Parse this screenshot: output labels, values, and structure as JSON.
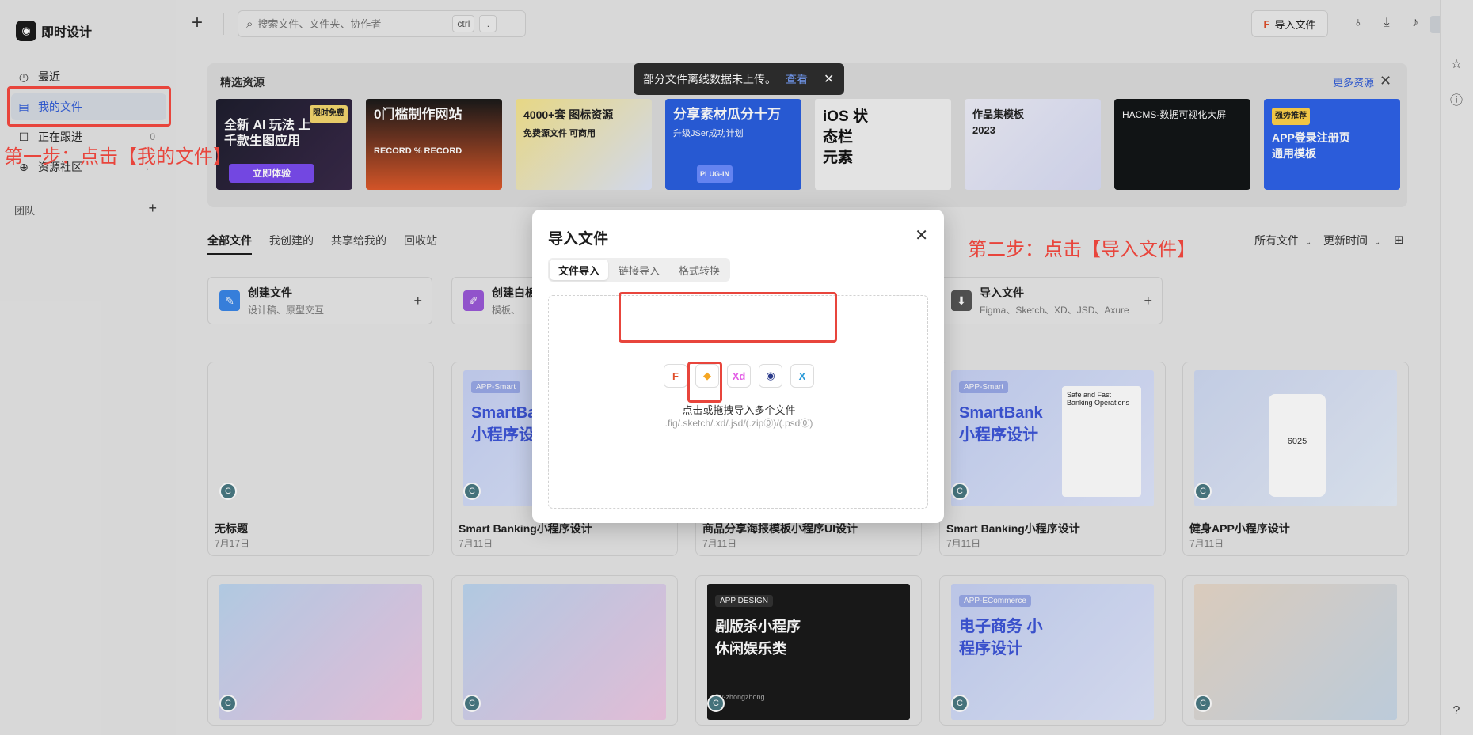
{
  "app": {
    "name": "即时设计"
  },
  "sidebar": {
    "items": [
      {
        "label": "最近",
        "icon": "clock-icon"
      },
      {
        "label": "我的文件",
        "icon": "file-icon"
      },
      {
        "label": "正在跟进",
        "icon": "bookmark-icon",
        "count": "0"
      },
      {
        "label": "资源社区",
        "icon": "globe-icon"
      }
    ],
    "team_label": "团队"
  },
  "topbar": {
    "search_placeholder": "搜索文件、文件夹、协作者",
    "shortcut_key1": "ctrl",
    "shortcut_key2": ".",
    "import_label": "导入文件"
  },
  "resources": {
    "title": "精选资源",
    "more_label": "更多资源",
    "banners": [
      {
        "title": "全新 AI 玩法 上千款生图应用",
        "cta": "立即体验",
        "tag": "限时免费"
      },
      {
        "title": "0门槛制作网站",
        "sub": "RECORD % RECORD"
      },
      {
        "title": "4000+套 图标资源",
        "sub": "免费源文件 可商用"
      },
      {
        "title": "分享素材瓜分十万",
        "sub": "升级JSer成功计划",
        "tag": "PLUG-IN"
      },
      {
        "title": "iOS 状态栏 元素"
      },
      {
        "title": "作品集模板 2023"
      },
      {
        "title": "HACMS-数据可视化大屏"
      },
      {
        "title": "APP登录注册页 通用模板",
        "tag": "强势推荐"
      }
    ]
  },
  "toast": {
    "message": "部分文件离线数据未上传。",
    "link": "查看"
  },
  "tabs": [
    {
      "label": "全部文件",
      "active": true
    },
    {
      "label": "我创建的",
      "active": false
    },
    {
      "label": "共享给我的",
      "active": false
    },
    {
      "label": "回收站",
      "active": false
    }
  ],
  "filters": {
    "type": "所有文件",
    "sort": "更新时间"
  },
  "create_cards": [
    {
      "title": "创建文件",
      "desc": "设计稿、原型交互"
    },
    {
      "title": "创建白板",
      "desc": "模板、"
    },
    {
      "title": "导入文件",
      "desc": "Figma、Sketch、XD、JSD、Axure"
    }
  ],
  "files": [
    {
      "name": "无标题",
      "date": "7月17日"
    },
    {
      "name": "Smart Banking小程序设计",
      "date": "7月11日",
      "thumb_title": "SmartBank 小程序设计",
      "thumb_tag": "APP-Smart"
    },
    {
      "name": "商品分享海报模板小程序UI设计",
      "date": "7月11日"
    },
    {
      "name": "Smart Banking小程序设计",
      "date": "7月11日",
      "thumb_title": "SmartBank 小程序设计",
      "thumb_tag": "APP-Smart",
      "thumb_note": "Safe and Fast Banking Operations"
    },
    {
      "name": "健身APP小程序设计",
      "date": "7月11日",
      "thumb_number": "6025"
    }
  ],
  "files_row2": [
    {
      "thumb_title": ""
    },
    {
      "thumb_title": ""
    },
    {
      "thumb_title": "剧版杀小程序 休闲娱乐类",
      "thumb_tag": "APP DESIGN",
      "thumb_author": "By-zhongzhong"
    },
    {
      "thumb_title": "电子商务 小程序设计",
      "thumb_tag": "APP-ECommerce"
    },
    {
      "thumb_title": ""
    }
  ],
  "avatar_letter": "C",
  "modal": {
    "title": "导入文件",
    "tabs": [
      {
        "label": "文件导入",
        "active": true
      },
      {
        "label": "链接导入",
        "active": false
      },
      {
        "label": "格式转换",
        "active": false
      }
    ],
    "formats": [
      {
        "name": "figma-icon",
        "glyph": "F"
      },
      {
        "name": "sketch-icon",
        "glyph": "◆"
      },
      {
        "name": "xd-icon",
        "glyph": "Xd"
      },
      {
        "name": "jsd-icon",
        "glyph": "◉"
      },
      {
        "name": "axure-icon",
        "glyph": "X"
      }
    ],
    "hint": "点击或拖拽导入多个文件",
    "sub": ".fig/.sketch/.xd/.jsd/(.zip⓪)/(.psd⓪)"
  },
  "annotations": {
    "step1": "第一步：点击【我的文件】",
    "step2": "第二步：点击【导入文件】"
  },
  "colors": {
    "accent": "#2f5cd8",
    "annotation": "#e8453c",
    "toast_bg": "#2e2e2e"
  }
}
